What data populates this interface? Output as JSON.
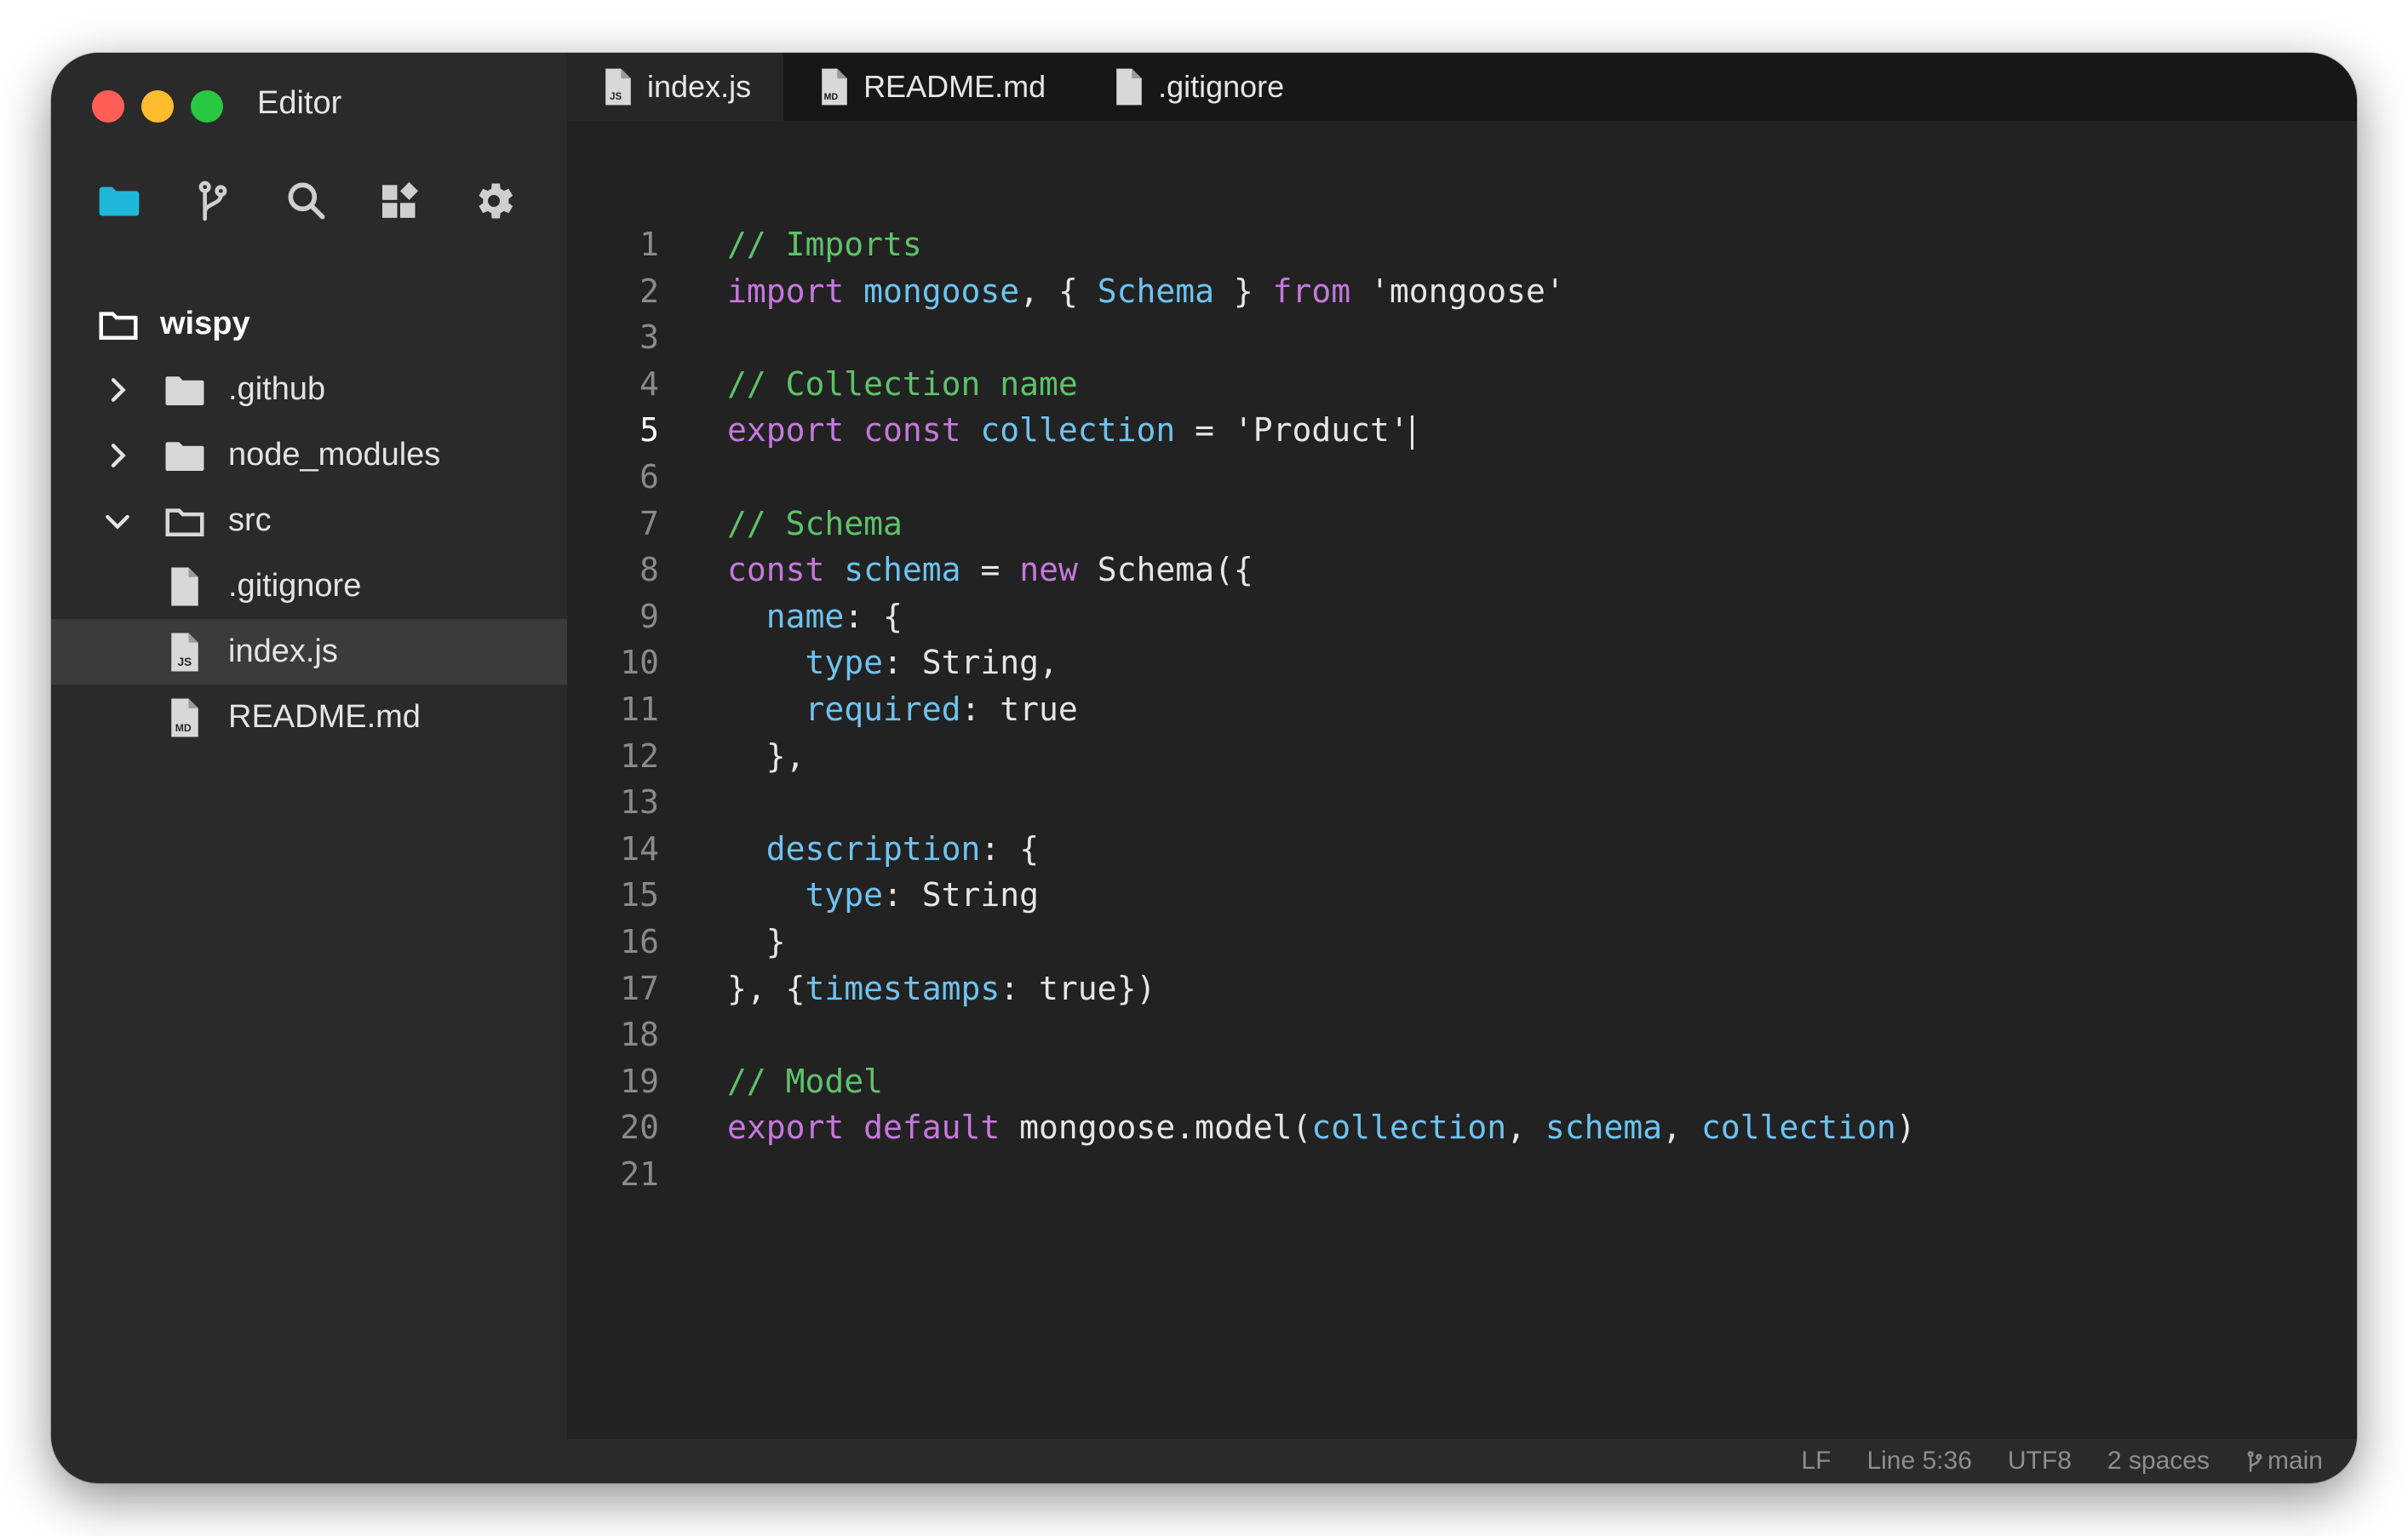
{
  "window": {
    "title": "Editor",
    "traffic_lights": [
      "#ff5f57",
      "#febc2e",
      "#28c840"
    ]
  },
  "activity_bar": [
    {
      "icon": "folder-icon",
      "color": "#1fb8d9"
    },
    {
      "icon": "source-control-icon",
      "color": "#cfcfcf"
    },
    {
      "icon": "search-icon",
      "color": "#cfcfcf"
    },
    {
      "icon": "extensions-icon",
      "color": "#cfcfcf"
    },
    {
      "icon": "gear-icon",
      "color": "#cfcfcf"
    }
  ],
  "explorer": {
    "root": "wispy",
    "items": [
      {
        "label": ".github",
        "type": "folder",
        "state": "collapsed"
      },
      {
        "label": "node_modules",
        "type": "folder",
        "state": "collapsed"
      },
      {
        "label": "src",
        "type": "folder",
        "state": "expanded"
      },
      {
        "label": ".gitignore",
        "type": "file",
        "badge": ""
      },
      {
        "label": "index.js",
        "type": "file",
        "badge": "JS",
        "selected": true
      },
      {
        "label": "README.md",
        "type": "file",
        "badge": "MD"
      }
    ]
  },
  "tabs": [
    {
      "label": "index.js",
      "badge": "JS",
      "active": true
    },
    {
      "label": "README.md",
      "badge": "MD",
      "active": false
    },
    {
      "label": ".gitignore",
      "badge": "",
      "active": false
    }
  ],
  "editor": {
    "current_line": 5,
    "lines": [
      [
        [
          "com",
          "// Imports"
        ]
      ],
      [
        [
          "kw",
          "import "
        ],
        [
          "id",
          "mongoose"
        ],
        [
          "txt",
          ", { "
        ],
        [
          "id",
          "Schema"
        ],
        [
          "txt",
          " } "
        ],
        [
          "kw",
          "from"
        ],
        [
          "txt",
          " 'mongoose'"
        ]
      ],
      [],
      [
        [
          "com",
          "// Collection name"
        ]
      ],
      [
        [
          "kw",
          "export const "
        ],
        [
          "id",
          "collection"
        ],
        [
          "txt",
          " = 'Product'"
        ]
      ],
      [],
      [
        [
          "com",
          "// Schema"
        ]
      ],
      [
        [
          "kw",
          "const "
        ],
        [
          "id",
          "schema"
        ],
        [
          "txt",
          " = "
        ],
        [
          "kw",
          "new "
        ],
        [
          "txt",
          "Schema({"
        ]
      ],
      [
        [
          "txt",
          "  "
        ],
        [
          "id",
          "name"
        ],
        [
          "txt",
          ": {"
        ]
      ],
      [
        [
          "txt",
          "    "
        ],
        [
          "id",
          "type"
        ],
        [
          "txt",
          ": String,"
        ]
      ],
      [
        [
          "txt",
          "    "
        ],
        [
          "id",
          "required"
        ],
        [
          "txt",
          ": true"
        ]
      ],
      [
        [
          "txt",
          "  },"
        ]
      ],
      [],
      [
        [
          "txt",
          "  "
        ],
        [
          "id",
          "description"
        ],
        [
          "txt",
          ": {"
        ]
      ],
      [
        [
          "txt",
          "    "
        ],
        [
          "id",
          "type"
        ],
        [
          "txt",
          ": String"
        ]
      ],
      [
        [
          "txt",
          "  }"
        ]
      ],
      [
        [
          "txt",
          "}, {"
        ],
        [
          "id",
          "timestamps"
        ],
        [
          "txt",
          ": true})"
        ]
      ],
      [],
      [
        [
          "com",
          "// Model"
        ]
      ],
      [
        [
          "kw",
          "export default "
        ],
        [
          "txt",
          "mongoose.model("
        ],
        [
          "id",
          "collection"
        ],
        [
          "txt",
          ", "
        ],
        [
          "id",
          "schema"
        ],
        [
          "txt",
          ", "
        ],
        [
          "id",
          "collection"
        ],
        [
          "txt",
          ")"
        ]
      ],
      []
    ]
  },
  "status": {
    "line_ending": "LF",
    "position": "Line 5:36",
    "encoding": "UTF8",
    "indent": "2 spaces",
    "branch": "main"
  }
}
